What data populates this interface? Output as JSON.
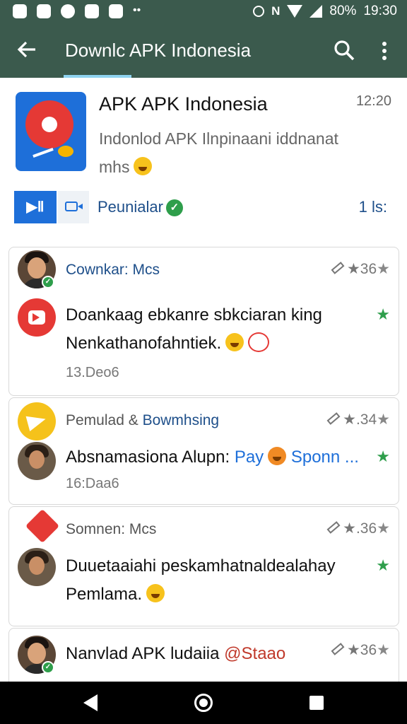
{
  "status_bar": {
    "battery": "80%",
    "time": "19:30",
    "left_icons": [
      "gallery-icon",
      "message-icon",
      "record-icon",
      "update-icon",
      "home-icon"
    ],
    "more": "••"
  },
  "app_bar": {
    "title": "Downlc APK Indonesia",
    "back_icon": "arrow-back-icon",
    "search_icon": "search-icon",
    "more_icon": "more-vert-icon"
  },
  "app_header": {
    "name": "APK APK Indonesia",
    "time": "12:20",
    "description_line1": "Indonlod APK Ilnpinaani iddnanat",
    "description_line2": "mhs",
    "button_label": "▶Ⅱ",
    "verified_label": "Peunialar",
    "count_label": "1 ls:"
  },
  "posts": [
    {
      "sender": "Cownkar: Mcs",
      "meta": "★36",
      "text_line1": "Doankaag ebkanre sbkciaran king",
      "text_line2": "Nenkathanofahntiek.",
      "date": "13.Deo6"
    },
    {
      "sender_prefix": "Pemulad & ",
      "sender_link": "Bowmhsing",
      "meta": "★.34",
      "text_prefix": "Absnamasiona Alupn: ",
      "text_link": "Pay",
      "text_suffix": " Sponn ...",
      "date": "16:Daa6"
    },
    {
      "sender": "Somnen: Mcs",
      "meta": "★.36",
      "text_line1": "Duuetaaiahi peskamhatnaldealahay",
      "text_line2": "Pemlama."
    },
    {
      "text_line1": "Nanvlad APK ludaiia",
      "text_tail": "@Staao",
      "meta": "★36"
    }
  ],
  "colors": {
    "app_bar": "#3b5a4d",
    "accent_blue": "#1e6fd9",
    "verified_green": "#2e9e4b",
    "red": "#e53935"
  }
}
